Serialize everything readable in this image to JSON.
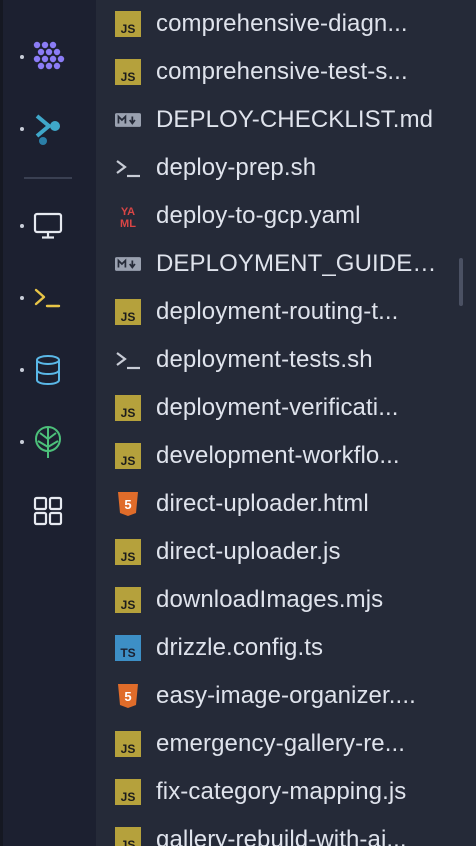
{
  "activity_bar": {
    "items": [
      {
        "name": "apps-icon"
      },
      {
        "name": "deploy-agent-icon"
      },
      {
        "name": "monitor-icon"
      },
      {
        "name": "terminal-icon"
      },
      {
        "name": "database-icon"
      },
      {
        "name": "git-tree-icon"
      },
      {
        "name": "extensions-grid-icon"
      }
    ]
  },
  "explorer": {
    "files": [
      {
        "label": "comprehensive-diagn...",
        "icon": "js-file-icon"
      },
      {
        "label": "comprehensive-test-s...",
        "icon": "js-file-icon"
      },
      {
        "label": "DEPLOY-CHECKLIST.md",
        "icon": "markdown-file-icon"
      },
      {
        "label": "deploy-prep.sh",
        "icon": "shell-file-icon"
      },
      {
        "label": "deploy-to-gcp.yaml",
        "icon": "yaml-file-icon"
      },
      {
        "label": "DEPLOYMENT_GUIDE....",
        "icon": "markdown-file-icon"
      },
      {
        "label": "deployment-routing-t...",
        "icon": "js-file-icon"
      },
      {
        "label": "deployment-tests.sh",
        "icon": "shell-file-icon"
      },
      {
        "label": "deployment-verificati...",
        "icon": "js-file-icon"
      },
      {
        "label": "development-workflo...",
        "icon": "js-file-icon"
      },
      {
        "label": "direct-uploader.html",
        "icon": "html-file-icon"
      },
      {
        "label": "direct-uploader.js",
        "icon": "js-file-icon"
      },
      {
        "label": "downloadImages.mjs",
        "icon": "js-file-icon"
      },
      {
        "label": "drizzle.config.ts",
        "icon": "ts-file-icon"
      },
      {
        "label": "easy-image-organizer....",
        "icon": "html-file-icon"
      },
      {
        "label": "emergency-gallery-re...",
        "icon": "js-file-icon"
      },
      {
        "label": "fix-category-mapping.js",
        "icon": "js-file-icon"
      },
      {
        "label": "gallery-rebuild-with-ai...",
        "icon": "js-file-icon"
      }
    ]
  },
  "colors": {
    "activity_bg": "#1c2030",
    "explorer_bg": "#252a38",
    "text": "#dfe3ec",
    "js": "#b5a13c",
    "ts": "#3d8fc6",
    "html": "#e06c2a",
    "yaml": "#d94545",
    "markdown": "#9aa1b0",
    "shell": "#c8ccd6",
    "accent_purple": "#8b7cf6",
    "accent_teal": "#3fa7c9",
    "accent_green": "#4cc07a",
    "accent_yellow": "#e8c547"
  }
}
